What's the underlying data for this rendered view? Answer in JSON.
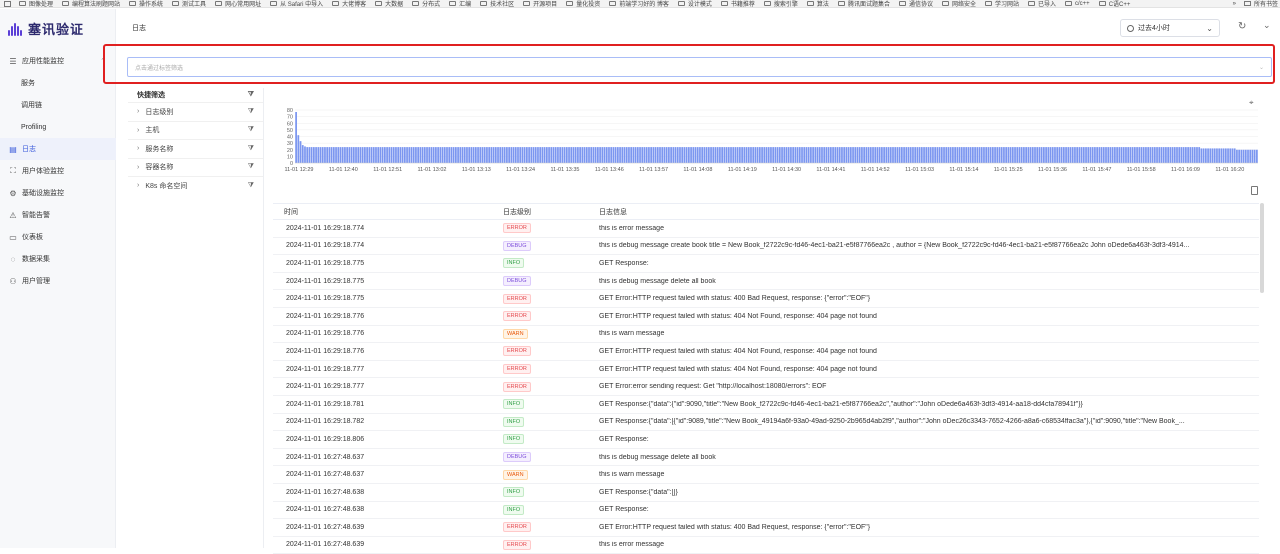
{
  "bookmarks": [
    "图像处理",
    "编程算法刷题网站",
    "操作系统",
    "测试工具",
    "网心常用网址",
    "从 Safari 中导入",
    "大佬博客",
    "大数据",
    "分布式",
    "汇编",
    "技术社区",
    "开源项目",
    "量化投资",
    "前端学习好的 博客",
    "设计模式",
    "书籍推荐",
    "搜索引擎",
    "算法",
    "腾讯面试题集合",
    "通信协议",
    "网络安全",
    "学习网站",
    "已导入",
    "c/c++",
    "C语C++"
  ],
  "bookmarks_more": "»",
  "bookmarks_all": "所有书签",
  "brand": {
    "name": "塞讯验证"
  },
  "nav": {
    "apm": "应用性能监控",
    "service": "服务",
    "trace": "调用链",
    "profiling": "Profiling",
    "logs": "日志",
    "rum": "用户体验监控",
    "infra": "基础设施监控",
    "alert": "智能告警",
    "dashboard": "仪表板",
    "collect": "数据采集",
    "users": "用户管理"
  },
  "header": {
    "title": "日志",
    "time_range": "过去4小时"
  },
  "search": {
    "placeholder": "点击通过标签筛选"
  },
  "quick_filter": {
    "title": "快捷筛选",
    "items": [
      {
        "label": "日志级别"
      },
      {
        "label": "主机"
      },
      {
        "label": "服务名称"
      },
      {
        "label": "容器名称"
      },
      {
        "label": "K8s 命名空间"
      }
    ]
  },
  "chart_data": {
    "type": "bar",
    "title": "",
    "xlabel": "",
    "ylabel": "",
    "ylim": [
      0,
      80
    ],
    "yticks": [
      0,
      10,
      20,
      30,
      40,
      50,
      60,
      70,
      80
    ],
    "xticks": [
      "11-01 12:29",
      "11-01 12:40",
      "11-01 12:51",
      "11-01 13:02",
      "11-01 13:13",
      "11-01 13:24",
      "11-01 13:35",
      "11-01 13:46",
      "11-01 13:57",
      "11-01 14:08",
      "11-01 14:19",
      "11-01 14:30",
      "11-01 14:41",
      "11-01 14:52",
      "11-01 15:03",
      "11-01 15:14",
      "11-01 15:25",
      "11-01 15:36",
      "11-01 15:47",
      "11-01 15:58",
      "11-01 16:09",
      "11-01 16:20"
    ],
    "color": "#7b96f0",
    "grid": true,
    "values": [
      77,
      42,
      33,
      27,
      25,
      24,
      24,
      24,
      24,
      24,
      24,
      24,
      24,
      24,
      24,
      24,
      24,
      24,
      24,
      24,
      24,
      24,
      24,
      24,
      24,
      24,
      24,
      24,
      24,
      24,
      24,
      24,
      24,
      24,
      24,
      24,
      24,
      24,
      24,
      24,
      24,
      24,
      24,
      24,
      24,
      24,
      24,
      24,
      24,
      24,
      24,
      24,
      24,
      24,
      24,
      24,
      24,
      24,
      24,
      24,
      24,
      24,
      24,
      24,
      24,
      24,
      24,
      24,
      24,
      24,
      24,
      24,
      24,
      24,
      24,
      24,
      24,
      24,
      24,
      24,
      24,
      24,
      24,
      24,
      24,
      24,
      24,
      24,
      24,
      24,
      24,
      24,
      24,
      24,
      24,
      24,
      24,
      24,
      24,
      24,
      24,
      24,
      24,
      24,
      24,
      24,
      24,
      24,
      24,
      24,
      24,
      24,
      24,
      24,
      24,
      24,
      24,
      24,
      24,
      24,
      24,
      24,
      24,
      24,
      24,
      24,
      24,
      24,
      24,
      24,
      24,
      24,
      24,
      24,
      24,
      24,
      24,
      24,
      24,
      24,
      24,
      24,
      24,
      24,
      24,
      24,
      24,
      24,
      24,
      24,
      24,
      24,
      24,
      24,
      24,
      24,
      24,
      24,
      24,
      24,
      24,
      24,
      24,
      24,
      24,
      24,
      24,
      24,
      24,
      24,
      24,
      24,
      24,
      24,
      24,
      24,
      24,
      24,
      24,
      24,
      24,
      24,
      24,
      24,
      24,
      24,
      24,
      24,
      24,
      24,
      24,
      24,
      24,
      24,
      24,
      24,
      24,
      24,
      24,
      24,
      24,
      24,
      24,
      24,
      24,
      24,
      24,
      24,
      24,
      24,
      24,
      24,
      24,
      24,
      24,
      24,
      24,
      24,
      24,
      24,
      24,
      24,
      24,
      24,
      24,
      24,
      24,
      24,
      24,
      24,
      24,
      24,
      24,
      24,
      24,
      24,
      24,
      24,
      24,
      24,
      24,
      24,
      24,
      24,
      24,
      24,
      24,
      24,
      24,
      24,
      24,
      24,
      24,
      24,
      24,
      24,
      24,
      24,
      24,
      24,
      24,
      24,
      24,
      24,
      24,
      24,
      24,
      24,
      24,
      24,
      24,
      24,
      24,
      24,
      24,
      24,
      24,
      24,
      24,
      24,
      24,
      24,
      24,
      24,
      24,
      24,
      24,
      24,
      24,
      24,
      24,
      24,
      24,
      24,
      24,
      24,
      24,
      24,
      24,
      24,
      24,
      24,
      24,
      24,
      24,
      24,
      24,
      24,
      24,
      24,
      24,
      24,
      24,
      24,
      24,
      24,
      24,
      24,
      24,
      24,
      24,
      24,
      24,
      24,
      24,
      24,
      24,
      24,
      24,
      24,
      24,
      24,
      24,
      24,
      24,
      24,
      24,
      24,
      24,
      24,
      24,
      24,
      24,
      24,
      24,
      24,
      24,
      24,
      24,
      24,
      24,
      24,
      24,
      24,
      24,
      24,
      24,
      24,
      24,
      24,
      24,
      24,
      24,
      24,
      24,
      24,
      24,
      24,
      24,
      24,
      24,
      24,
      24,
      24,
      24,
      24,
      24,
      24,
      24,
      24,
      24,
      24,
      24,
      24,
      24,
      24,
      24,
      24,
      24,
      24,
      24,
      24,
      24,
      24,
      24,
      24,
      24,
      24,
      24,
      24,
      24,
      24,
      24,
      24,
      24,
      24,
      24,
      24,
      22,
      22,
      22,
      22,
      22,
      22,
      22,
      22,
      22,
      22,
      22,
      22,
      22,
      22,
      22,
      22,
      20,
      20,
      20,
      20,
      20,
      20,
      20,
      20,
      20,
      20
    ]
  },
  "table": {
    "headers": {
      "time": "时间",
      "level": "日志级别",
      "msg": "日志信息"
    },
    "rows": [
      {
        "time": "2024-11-01 16:29:18.774",
        "level": "ERROR",
        "msg": "this is error message"
      },
      {
        "time": "2024-11-01 16:29:18.774",
        "level": "DEBUG",
        "msg": "this is debug message create book title = New Book_f2722c9c-fd46-4ec1-ba21-e5f87766ea2c , author = {New Book_f2722c9c-fd46-4ec1-ba21-e5f87766ea2c John oDede6a463f-3df3-4914..."
      },
      {
        "time": "2024-11-01 16:29:18.775",
        "level": "INFO",
        "msg": "GET Response:"
      },
      {
        "time": "2024-11-01 16:29:18.775",
        "level": "DEBUG",
        "msg": "this is debug message delete all book"
      },
      {
        "time": "2024-11-01 16:29:18.775",
        "level": "ERROR",
        "msg": "GET Error:HTTP request failed with status: 400 Bad Request, response: {\"error\":\"EOF\"}"
      },
      {
        "time": "2024-11-01 16:29:18.776",
        "level": "ERROR",
        "msg": "GET Error:HTTP request failed with status: 404 Not Found, response: 404 page not found"
      },
      {
        "time": "2024-11-01 16:29:18.776",
        "level": "WARN",
        "msg": "this is warn message"
      },
      {
        "time": "2024-11-01 16:29:18.776",
        "level": "ERROR",
        "msg": "GET Error:HTTP request failed with status: 404 Not Found, response: 404 page not found"
      },
      {
        "time": "2024-11-01 16:29:18.777",
        "level": "ERROR",
        "msg": "GET Error:HTTP request failed with status: 404 Not Found, response: 404 page not found"
      },
      {
        "time": "2024-11-01 16:29:18.777",
        "level": "ERROR",
        "msg": "GET Error:error sending request: Get \"http://localhost:18080/errors\": EOF"
      },
      {
        "time": "2024-11-01 16:29:18.781",
        "level": "INFO",
        "msg": "GET Response:{\"data\":{\"id\":9090,\"title\":\"New Book_f2722c9c-fd46-4ec1-ba21-e5f87766ea2c\",\"author\":\"John oDede6a463f-3df3-4914-aa18-dd4cfa78941f\"}}"
      },
      {
        "time": "2024-11-01 16:29:18.782",
        "level": "INFO",
        "msg": "GET Response:{\"data\":[{\"id\":9089,\"title\":\"New Book_49194a6f-93a0-49ad-9250-2b965d4ab2f9\",\"author\":\"John oDec26c3343-7652-4266-a8a6-c68534ffac3a\"},{\"id\":9090,\"title\":\"New Book_..."
      },
      {
        "time": "2024-11-01 16:29:18.806",
        "level": "INFO",
        "msg": "GET Response:"
      },
      {
        "time": "2024-11-01 16:27:48.637",
        "level": "DEBUG",
        "msg": "this is debug message delete all book"
      },
      {
        "time": "2024-11-01 16:27:48.637",
        "level": "WARN",
        "msg": "this is warn message"
      },
      {
        "time": "2024-11-01 16:27:48.638",
        "level": "INFO",
        "msg": "GET Response:{\"data\":[]}"
      },
      {
        "time": "2024-11-01 16:27:48.638",
        "level": "INFO",
        "msg": "GET Response:"
      },
      {
        "time": "2024-11-01 16:27:48.639",
        "level": "ERROR",
        "msg": "GET Error:HTTP request failed with status: 400 Bad Request, response: {\"error\":\"EOF\"}"
      },
      {
        "time": "2024-11-01 16:27:48.639",
        "level": "ERROR",
        "msg": "this is error message"
      }
    ]
  },
  "icons": {
    "apm": "tree-list-icon",
    "logs": "log-icon",
    "rum": "user-experience-icon",
    "infra": "infra-icon",
    "alert": "alarm-icon",
    "dashboard": "dashboard-icon",
    "collect": "data-collect-icon",
    "users": "user-manage-icon"
  }
}
